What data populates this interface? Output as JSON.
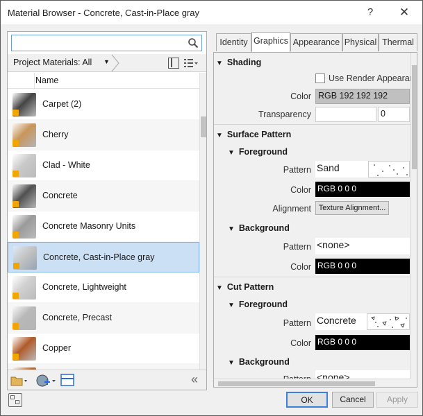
{
  "window": {
    "title": "Material Browser - Concrete, Cast-in-Place gray",
    "help": "?",
    "close": "✕"
  },
  "left": {
    "search_placeholder": "",
    "project_filter": "Project Materials: All",
    "column_name": "Name",
    "materials": [
      {
        "label": "Carpet (2)",
        "color": "#444444"
      },
      {
        "label": "Cherry",
        "color": "#c8955a"
      },
      {
        "label": "Clad - White",
        "color": "#c9c9c9"
      },
      {
        "label": "Concrete",
        "color": "#505050"
      },
      {
        "label": "Concrete Masonry Units",
        "color": "#9a9a9a"
      },
      {
        "label": "Concrete, Cast-in-Place gray",
        "color": "#c4c4c4"
      },
      {
        "label": "Concrete, Lightweight",
        "color": "#d0d0d0"
      },
      {
        "label": "Concrete, Precast",
        "color": "#b8b8b8"
      },
      {
        "label": "Copper",
        "color": "#b05a2a"
      },
      {
        "label": "",
        "color": "#a86a3a"
      }
    ],
    "selected_index": 5
  },
  "tabs": [
    "Identity",
    "Graphics",
    "Appearance",
    "Physical",
    "Thermal"
  ],
  "active_tab": "Graphics",
  "graphics": {
    "shading_title": "Shading",
    "use_render_label": "Use Render Appearance",
    "color_label": "Color",
    "shading_color": "RGB 192 192 192",
    "transparency_label": "Transparency",
    "transparency_value": "0",
    "surface_title": "Surface Pattern",
    "fg_title": "Foreground",
    "pattern_label": "Pattern",
    "surface_fg_pattern": "Sand",
    "surface_fg_color": "RGB 0 0 0",
    "alignment_label": "Alignment",
    "alignment_button": "Texture Alignment...",
    "bg_title": "Background",
    "surface_bg_pattern": "<none>",
    "surface_bg_color": "RGB 0 0 0",
    "cut_title": "Cut Pattern",
    "cut_fg_pattern": "Concrete",
    "cut_fg_color": "RGB 0 0 0",
    "cut_bg_pattern": "<none>"
  },
  "buttons": {
    "ok": "OK",
    "cancel": "Cancel",
    "apply": "Apply"
  }
}
